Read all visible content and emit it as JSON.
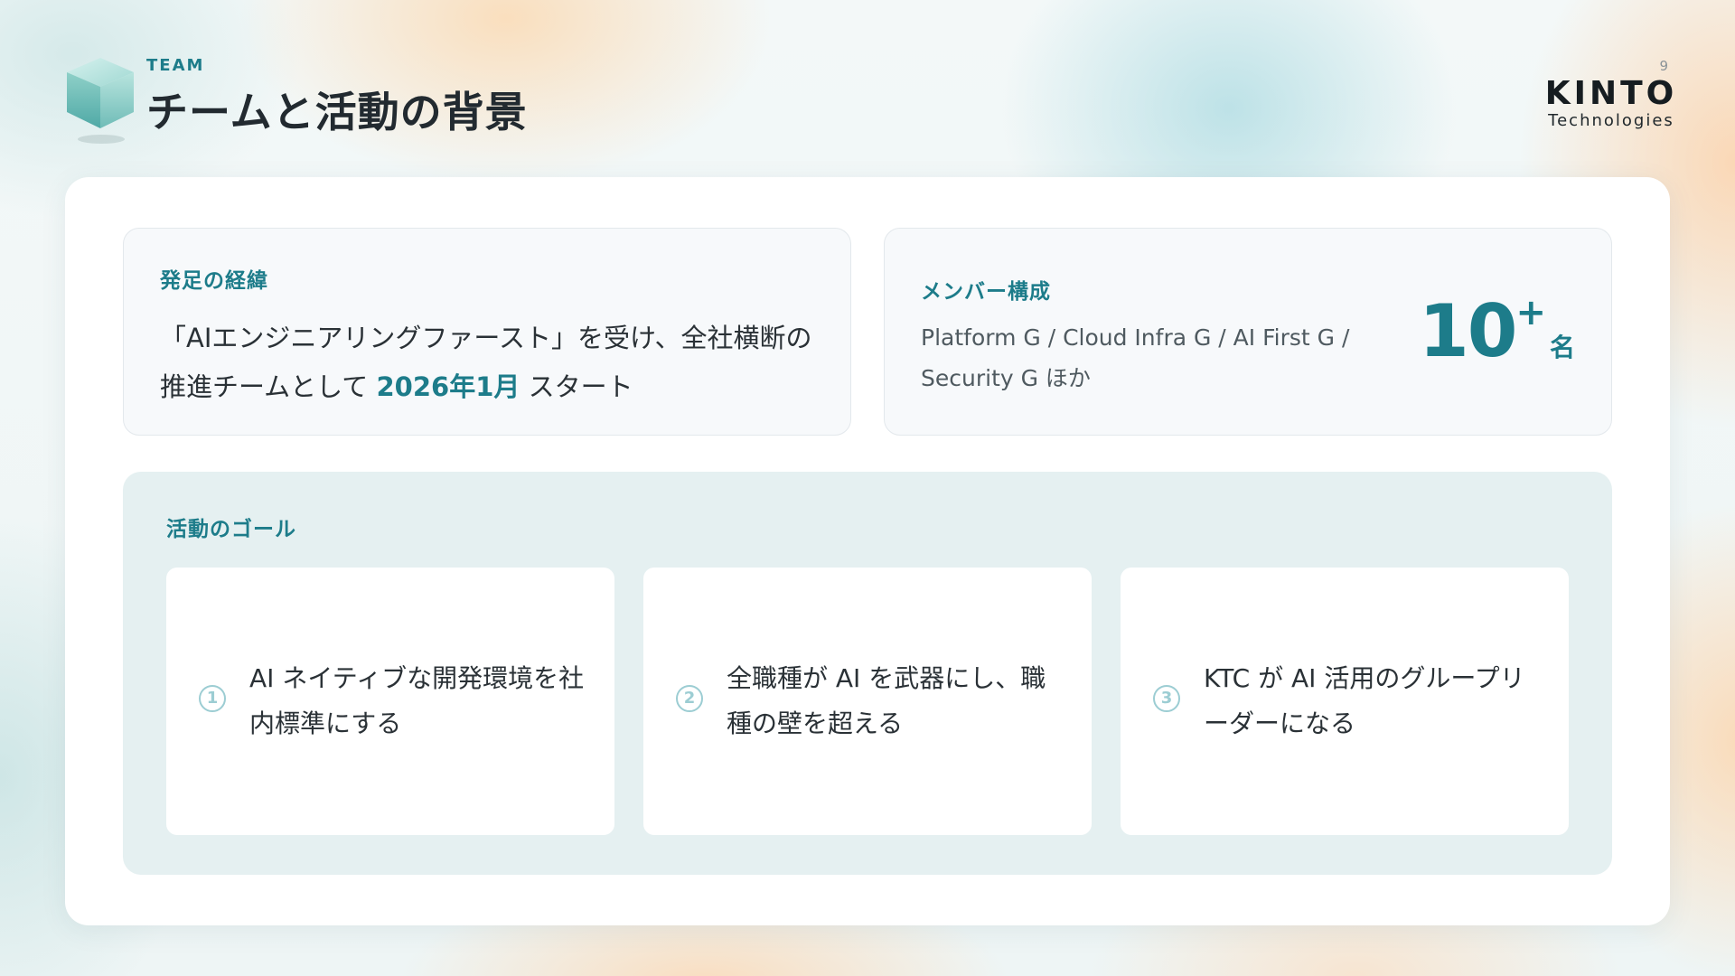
{
  "header": {
    "eyebrow": "TEAM",
    "title": "チームと活動の背景",
    "page_number": "9",
    "logo": {
      "name": "KINTO",
      "sub": "Technologies"
    }
  },
  "origin": {
    "label": "発足の経緯",
    "text_before": "「AIエンジニアリングファースト」を受け、全社横断の推進チームとして ",
    "highlight": "2026年1月",
    "text_after": " スタート"
  },
  "members": {
    "label": "メンバー構成",
    "groups": "Platform G / Cloud Infra G / AI First G / Security G ほか",
    "count": "10",
    "count_suffix": "+",
    "count_unit": "名"
  },
  "goals": {
    "label": "活動のゴール",
    "items": [
      {
        "number": "1",
        "text": "AI ネイティブな開発環境を社内標準にする"
      },
      {
        "number": "2",
        "text": "全職種が AI を武器にし、職種の壁を超える"
      },
      {
        "number": "3",
        "text": "KTC が AI 活用のグループリーダーになる"
      }
    ]
  },
  "colors": {
    "accent": "#1d7c8a",
    "goal_panel": "#e5f0f1",
    "goal_number": "#9ccdd3",
    "text": "#2a3136"
  }
}
